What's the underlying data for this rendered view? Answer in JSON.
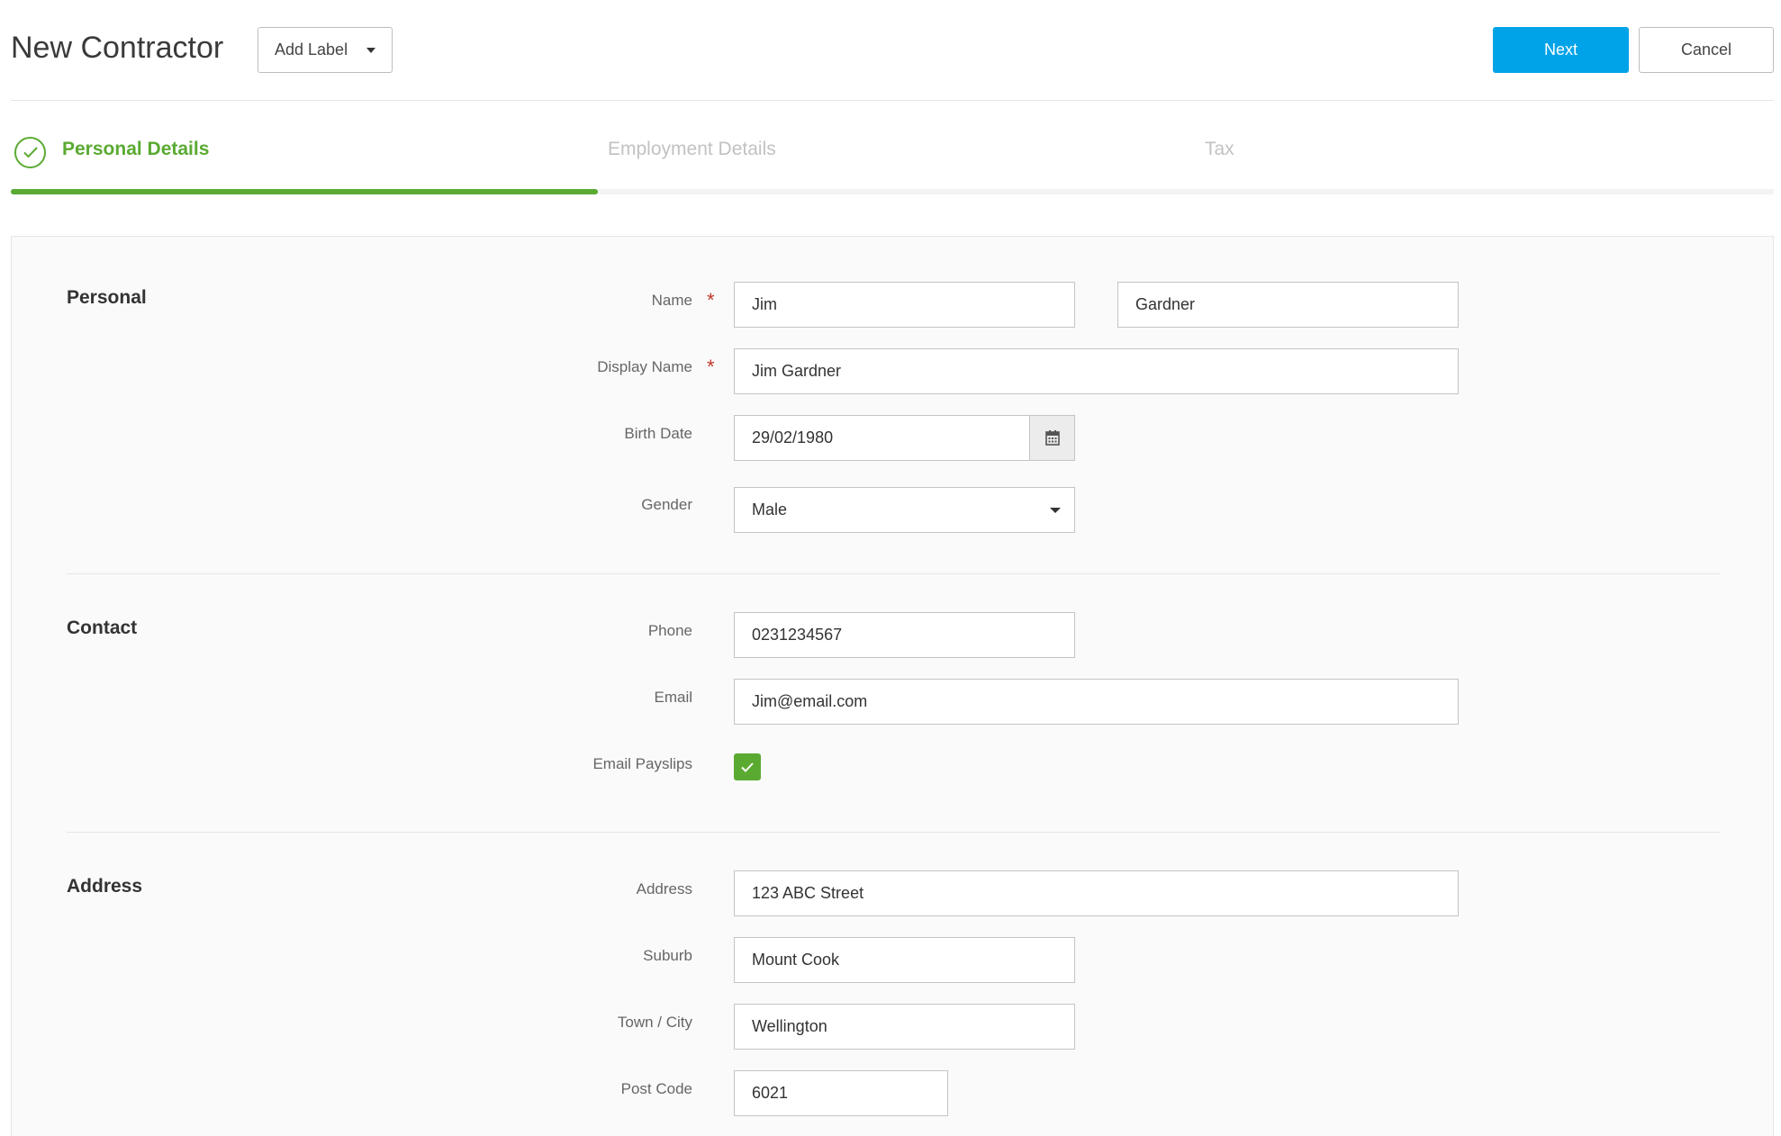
{
  "header": {
    "title": "New Contractor",
    "add_label": "Add Label",
    "next_label": "Next",
    "cancel_label": "Cancel"
  },
  "steps": {
    "items": [
      {
        "label": "Personal Details",
        "state": "complete"
      },
      {
        "label": "Employment Details",
        "state": "inactive"
      },
      {
        "label": "Tax",
        "state": "inactive"
      }
    ],
    "progress_fraction": 0.333,
    "accent_color": "#5aaa32"
  },
  "sections": {
    "personal": {
      "title": "Personal",
      "name_label": "Name",
      "first_name": "Jim",
      "last_name": "Gardner",
      "display_name_label": "Display Name",
      "display_name": "Jim Gardner",
      "birth_date_label": "Birth Date",
      "birth_date": "29/02/1980",
      "gender_label": "Gender",
      "gender": "Male",
      "required_mark": "*"
    },
    "contact": {
      "title": "Contact",
      "phone_label": "Phone",
      "phone": "0231234567",
      "email_label": "Email",
      "email": "Jim@email.com",
      "email_payslips_label": "Email Payslips",
      "email_payslips_checked": true
    },
    "address": {
      "title": "Address",
      "address_label": "Address",
      "address": "123 ABC Street",
      "suburb_label": "Suburb",
      "suburb": "Mount Cook",
      "city_label": "Town / City",
      "city": "Wellington",
      "postcode_label": "Post Code",
      "postcode": "6021"
    }
  },
  "colors": {
    "primary_button": "#00a3e8",
    "success": "#5aaa32",
    "required": "#c0392b"
  },
  "icons": {
    "step_complete": "check-circle-icon",
    "calendar": "calendar-icon",
    "dropdown": "caret-down-icon",
    "checkbox": "check-icon"
  }
}
